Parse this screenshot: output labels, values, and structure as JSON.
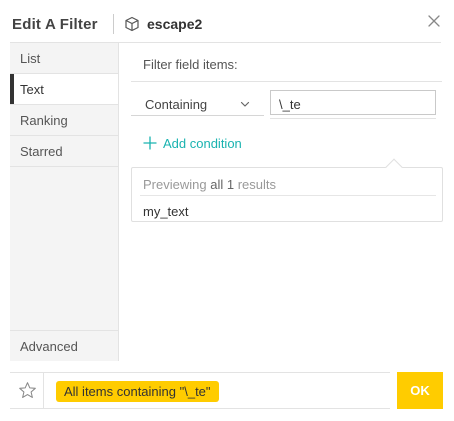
{
  "header": {
    "title": "Edit A Filter",
    "subject": "escape2",
    "subject_icon": "cube-icon",
    "close_icon": "close-icon"
  },
  "sidebar": {
    "tabs": [
      {
        "label": "List",
        "active": false
      },
      {
        "label": "Text",
        "active": true
      },
      {
        "label": "Ranking",
        "active": false
      },
      {
        "label": "Starred",
        "active": false
      }
    ],
    "bottom_tab": "Advanced"
  },
  "main": {
    "section_label": "Filter field items:",
    "operator": {
      "selected": "Containing"
    },
    "value_input": {
      "value": "\\_te",
      "placeholder": ""
    },
    "add_condition_label": "Add condition",
    "preview": {
      "prefix": "Previewing",
      "count_text": "all 1",
      "suffix": "results",
      "items": [
        "my_text"
      ]
    }
  },
  "footer": {
    "star_icon": "star-icon",
    "summary": "All items containing \"\\_te\"",
    "ok_label": "OK"
  },
  "colors": {
    "accent": "#ffcc00",
    "link": "#1ab3b0",
    "active_indicator": "#333333",
    "sidebar_bg": "#f4f4f4"
  }
}
